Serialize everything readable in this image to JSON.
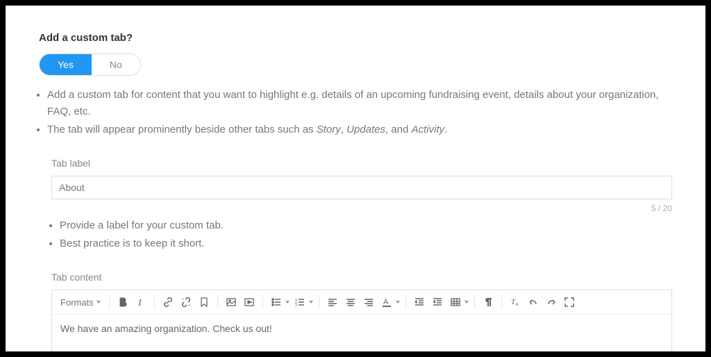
{
  "question": "Add a custom tab?",
  "toggle": {
    "yes": "Yes",
    "no": "No"
  },
  "hint1a": "Add a custom tab for content that you want to highlight e.g. details of an upcoming fundraising event, details about your organization, FAQ, etc.",
  "hint1b_pre": "The tab will appear prominently beside other tabs such as ",
  "hint1b_story": "Story",
  "hint1b_sep1": ", ",
  "hint1b_updates": "Updates",
  "hint1b_sep2": ", and ",
  "hint1b_activity": "Activity",
  "hint1b_post": ".",
  "tabLabel": {
    "label": "Tab label",
    "value": "About",
    "count": "5 / 20"
  },
  "hint2a": "Provide a label for your custom tab.",
  "hint2b": "Best practice is to keep it short.",
  "tabContent": {
    "label": "Tab content",
    "formats": "Formats",
    "body": "We have an amazing organization. Check us out!"
  }
}
